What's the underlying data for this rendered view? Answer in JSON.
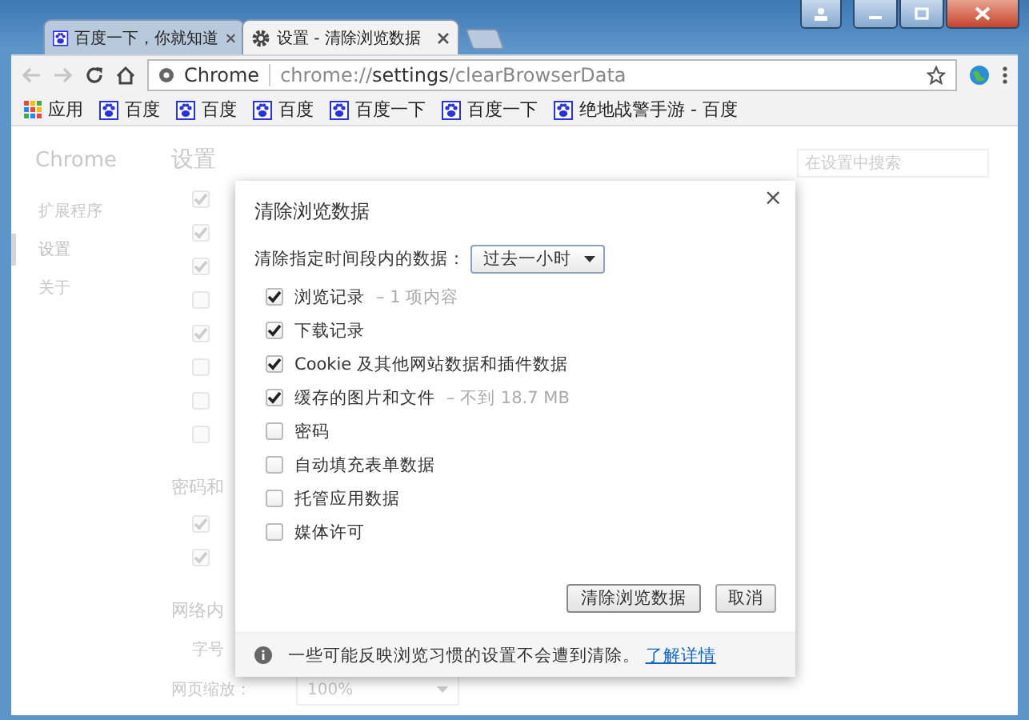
{
  "tabs": [
    {
      "title": "百度一下，你就知道",
      "kind": "site",
      "selected": false
    },
    {
      "title": "设置 - 清除浏览数据",
      "kind": "settings",
      "selected": true
    }
  ],
  "address_bar": {
    "site_label": "Chrome",
    "url": "chrome://**settings**/clearBrowserData"
  },
  "bookmarks": [
    {
      "label": "应用",
      "kind": "apps"
    },
    {
      "label": "百度",
      "kind": "site"
    },
    {
      "label": "百度",
      "kind": "site"
    },
    {
      "label": "百度",
      "kind": "site"
    },
    {
      "label": "百度一下",
      "kind": "site"
    },
    {
      "label": "百度一下",
      "kind": "site"
    },
    {
      "label": "绝地战警手游 - 百度",
      "kind": "site"
    }
  ],
  "settings_page": {
    "brand": "Chrome",
    "title": "设置",
    "nav": [
      {
        "label": "扩展程序",
        "selected": false
      },
      {
        "label": "设置",
        "selected": true
      },
      {
        "label": "关于",
        "selected": false
      }
    ],
    "search": {
      "placeholder": "在设置中搜索"
    },
    "privacy_checks": [
      {
        "checked": true
      },
      {
        "checked": true
      },
      {
        "checked": true
      },
      {
        "checked": false
      },
      {
        "checked": true
      },
      {
        "checked": false
      },
      {
        "checked": false
      },
      {
        "checked": false
      }
    ],
    "passwords_heading": "密码和",
    "password_checks": [
      {
        "checked": true
      },
      {
        "checked": true
      }
    ],
    "web_content_heading": "网络内",
    "font_label": "字号",
    "zoom_label": "网页缩放：",
    "zoom_value": "100%"
  },
  "dialog": {
    "title": "清除浏览数据",
    "close": "×",
    "range_label": "清除指定时间段内的数据：",
    "range_value": "过去一小时",
    "items": [
      {
        "label": "浏览记录",
        "detail": "– 1 项内容",
        "checked": true
      },
      {
        "label": "下载记录",
        "checked": true
      },
      {
        "label": "Cookie 及其他网站数据和插件数据",
        "checked": true
      },
      {
        "label": "缓存的图片和文件",
        "detail": "– 不到 18.7 MB",
        "checked": true
      },
      {
        "label": "密码",
        "checked": false
      },
      {
        "label": "自动填充表单数据",
        "checked": false
      },
      {
        "label": "托管应用数据",
        "checked": false
      },
      {
        "label": "媒体许可",
        "checked": false
      }
    ],
    "buttons": [
      {
        "label": "清除浏览数据",
        "kind": "primary"
      },
      {
        "label": "取消",
        "kind": "plain"
      }
    ],
    "footer": {
      "note": "一些可能反映浏览习惯的设置不会遭到清除。",
      "link": "了解详情"
    }
  }
}
